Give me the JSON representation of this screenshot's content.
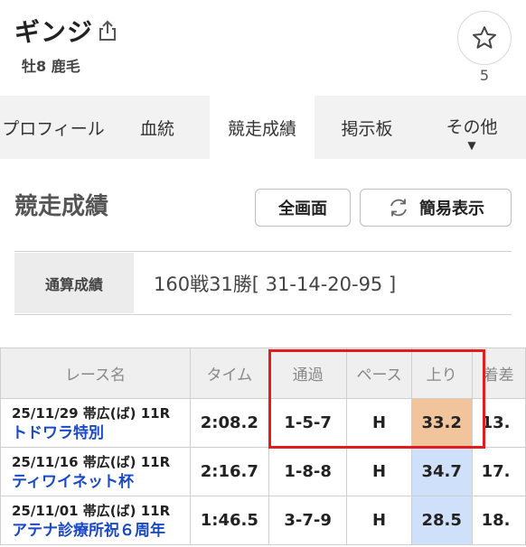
{
  "header": {
    "horse_name": "ギンジ",
    "meta": "牡8  鹿毛",
    "favorite_count": "5"
  },
  "tabs": [
    {
      "label": "プロフィール"
    },
    {
      "label": "血統"
    },
    {
      "label": "競走成績",
      "active": true
    },
    {
      "label": "掲示板"
    },
    {
      "label": "その他"
    }
  ],
  "section": {
    "title": "競走成績",
    "full_screen_label": "全画面",
    "simple_view_label": "簡易表示"
  },
  "summary": {
    "label": "通算成績",
    "value": "160戦31勝[ 31-14-20-95 ]"
  },
  "table": {
    "headers": [
      "レース名",
      "タイム",
      "通過",
      "ペース",
      "上り",
      "着差"
    ],
    "header_partial": "着差",
    "rows": [
      {
        "date": "25/11/29 帯広(ば) 11R",
        "race": "トドワラ特別",
        "time": "2:08.2",
        "passing": "1-5-7",
        "pace": "H",
        "last": "33.2",
        "margin": "13.",
        "last_color": "#f2c49b"
      },
      {
        "date": "25/11/16 帯広(ば) 11R",
        "race": "ティワイネット杯",
        "time": "2:16.7",
        "passing": "1-8-8",
        "pace": "H",
        "last": "34.7",
        "margin": "17.",
        "last_color": "#cfe0fa"
      },
      {
        "date": "25/11/01 帯広(ば) 11R",
        "race": "アテナ診療所祝６周年",
        "time": "1:46.5",
        "passing": "3-7-9",
        "pace": "H",
        "last": "28.5",
        "margin": "18.",
        "last_color": "#cfe0fa"
      }
    ]
  },
  "colors": {
    "accent_link": "#1a49c8",
    "highlight": "#e11d1d"
  },
  "icons": {
    "share": "share-icon",
    "favorite": "star-icon",
    "refresh": "refresh-icon",
    "dropdown": "caret-down-icon"
  }
}
